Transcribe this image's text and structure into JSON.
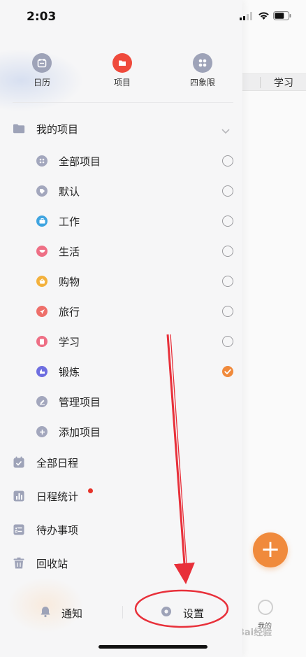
{
  "status_bar": {
    "time": "2:03"
  },
  "top_nav": [
    {
      "label": "日历",
      "icon": "calendar-icon",
      "color": "#9ea3b8"
    },
    {
      "label": "项目",
      "icon": "folder-icon",
      "color": "#ef4a3c"
    },
    {
      "label": "四象限",
      "icon": "grid-icon",
      "color": "#9ea3b8"
    }
  ],
  "my_projects": {
    "label": "我的项目",
    "icon": "folder-icon"
  },
  "project_items": [
    {
      "label": "全部项目",
      "icon": "grid-icon",
      "color": "#a3a7bd",
      "checked": false
    },
    {
      "label": "默认",
      "icon": "tag-icon",
      "color": "#a3a7bd",
      "checked": false
    },
    {
      "label": "工作",
      "icon": "briefcase-icon",
      "color": "#3fa4e0",
      "checked": false
    },
    {
      "label": "生活",
      "icon": "cup-icon",
      "color": "#ee6f85",
      "checked": false
    },
    {
      "label": "购物",
      "icon": "basket-icon",
      "color": "#f3b13c",
      "checked": false
    },
    {
      "label": "旅行",
      "icon": "plane-icon",
      "color": "#ee6f6a",
      "checked": false
    },
    {
      "label": "学习",
      "icon": "book-icon",
      "color": "#ee6f85",
      "checked": false
    },
    {
      "label": "锻炼",
      "icon": "dumbbell-icon",
      "color": "#6e6ee0",
      "checked": true
    }
  ],
  "project_actions": [
    {
      "label": "管理项目",
      "icon": "edit-icon",
      "color": "#a3a7bd"
    },
    {
      "label": "添加项目",
      "icon": "plus-icon",
      "color": "#a3a7bd"
    }
  ],
  "main_items": [
    {
      "label": "全部日程",
      "icon": "calendar-check-icon"
    },
    {
      "label": "日程统计",
      "icon": "chart-icon"
    },
    {
      "label": "待办事项",
      "icon": "checklist-icon"
    },
    {
      "label": "回收站",
      "icon": "trash-icon"
    }
  ],
  "bottom": {
    "notify": "通知",
    "settings": "设置"
  },
  "background": {
    "tab_label": "学习",
    "mine_label": "我的",
    "fab_symbol": "+"
  },
  "watermark": "Bai经验",
  "colors": {
    "accent": "#f08a3c",
    "annotation": "#e8303a",
    "icon_gray": "#a3a7bd"
  }
}
